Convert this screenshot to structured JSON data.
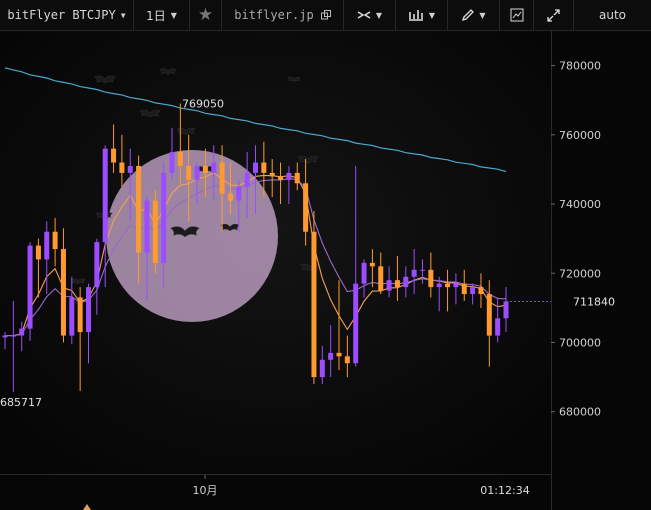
{
  "toolbar": {
    "symbol": "bitFlyer BTCJPY",
    "interval": "1日",
    "url": "bitflyer.jp",
    "autoscale": "auto"
  },
  "chart_data": {
    "type": "candlestick",
    "title": "",
    "ylim": [
      662000,
      790000
    ],
    "y_ticks": [
      780000,
      760000,
      740000,
      720000,
      700000,
      680000
    ],
    "x_ticks": [
      "10月"
    ],
    "current_price_label": "711840",
    "time_label": "01:12:34",
    "annotations": {
      "high": "769050",
      "low": "685717"
    },
    "colors": {
      "up": "#9b4dff",
      "down": "#ff9a30",
      "ma_fast": "#f3a150",
      "ma_mid": "#9a6ac8",
      "ma_slow": "#4aa8cc",
      "moon": "#d4b2da"
    },
    "candles": [
      [
        701500,
        703000,
        698000,
        702000
      ],
      [
        702000,
        712000,
        685717,
        702000
      ],
      [
        702000,
        706000,
        697500,
        704000
      ],
      [
        704000,
        729000,
        700500,
        728000
      ],
      [
        728000,
        730000,
        713000,
        724000
      ],
      [
        724000,
        735000,
        714000,
        732000
      ],
      [
        732000,
        736000,
        722000,
        727000
      ],
      [
        727000,
        733000,
        700000,
        702000
      ],
      [
        702000,
        719000,
        699500,
        713000
      ],
      [
        713000,
        716000,
        686000,
        703000
      ],
      [
        703000,
        717000,
        694000,
        716000
      ],
      [
        716000,
        730000,
        708000,
        729000
      ],
      [
        729000,
        757000,
        716000,
        756000
      ],
      [
        756000,
        763000,
        749000,
        752000
      ],
      [
        752000,
        760000,
        745000,
        749000
      ],
      [
        749000,
        756000,
        735000,
        751000
      ],
      [
        751000,
        754000,
        717000,
        726000
      ],
      [
        726000,
        742000,
        712000,
        741000
      ],
      [
        741000,
        744000,
        720000,
        723000
      ],
      [
        723000,
        752000,
        716000,
        749000
      ],
      [
        749000,
        762000,
        747000,
        755000
      ],
      [
        755000,
        769050,
        746000,
        751000
      ],
      [
        751000,
        760000,
        735000,
        747000
      ],
      [
        747000,
        752000,
        740000,
        751000
      ],
      [
        751000,
        756000,
        742000,
        749000
      ],
      [
        749000,
        757000,
        741000,
        752000
      ],
      [
        752000,
        757000,
        732000,
        743000
      ],
      [
        743000,
        752000,
        737000,
        741000
      ],
      [
        741000,
        747000,
        732000,
        745000
      ],
      [
        745000,
        755000,
        736000,
        749000
      ],
      [
        749000,
        757000,
        737000,
        752000
      ],
      [
        752000,
        758000,
        742000,
        749000
      ],
      [
        749000,
        753000,
        742000,
        748000
      ],
      [
        748000,
        752000,
        740000,
        747000
      ],
      [
        747000,
        751000,
        740000,
        749000
      ],
      [
        749000,
        752000,
        744000,
        746000
      ],
      [
        746000,
        753000,
        728000,
        732000
      ],
      [
        732000,
        738000,
        688000,
        690000
      ],
      [
        690000,
        699000,
        688000,
        695000
      ],
      [
        695000,
        705000,
        690000,
        697000
      ],
      [
        697000,
        718000,
        692000,
        696000
      ],
      [
        696000,
        702000,
        690000,
        694000
      ],
      [
        694000,
        751000,
        693000,
        717000
      ],
      [
        717000,
        724000,
        713000,
        723000
      ],
      [
        723000,
        727000,
        716000,
        722000
      ],
      [
        722000,
        726000,
        714000,
        715000
      ],
      [
        715000,
        722000,
        713000,
        718000
      ],
      [
        718000,
        725000,
        712000,
        716000
      ],
      [
        716000,
        722000,
        713000,
        719000
      ],
      [
        719000,
        727000,
        714000,
        721000
      ],
      [
        721000,
        724000,
        717000,
        721000
      ],
      [
        721000,
        726000,
        713000,
        716000
      ],
      [
        716000,
        719000,
        709000,
        717000
      ],
      [
        717000,
        721000,
        709000,
        716000
      ],
      [
        716000,
        720000,
        711000,
        717000
      ],
      [
        717000,
        721000,
        712000,
        714000
      ],
      [
        714000,
        717000,
        711000,
        716000
      ],
      [
        716000,
        720000,
        710000,
        714000
      ],
      [
        714000,
        718000,
        693000,
        702000
      ],
      [
        702000,
        713000,
        700000,
        707000
      ],
      [
        707000,
        716000,
        703000,
        711840
      ]
    ]
  }
}
